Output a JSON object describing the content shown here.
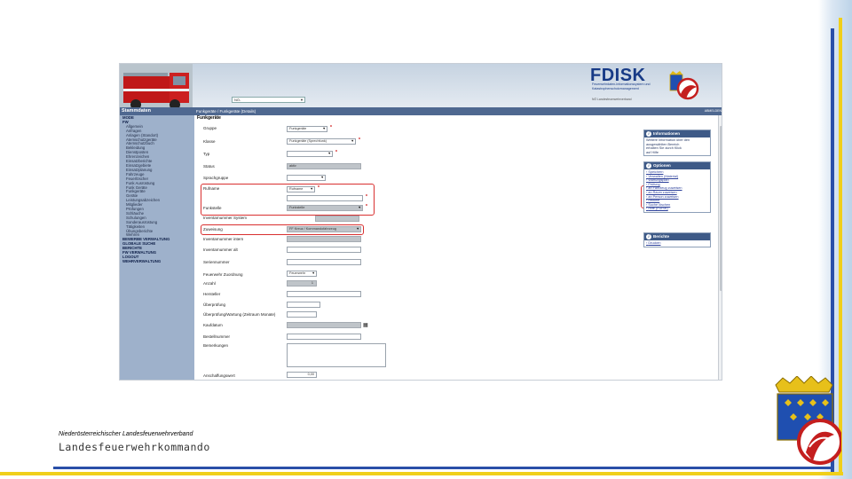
{
  "app": {
    "title": "FDISK",
    "subtitle_line1": "Feuerwehrdaten-Informationssystem und",
    "subtitle_line2": "Katastrophenschutzmanagement",
    "small_note": "NÖ Landesfeuerwehrverband",
    "mode": "Stammdaten",
    "breadcrumb": "Funkgeräte / Funkgeräte (Details)",
    "user_select": "NÖ-",
    "top_right": "ABMELDEN"
  },
  "sidebar": {
    "items": [
      {
        "label": "MODE",
        "level": 0
      },
      {
        "label": "FW",
        "level": 0
      },
      {
        "label": "Allgemein",
        "level": 1
      },
      {
        "label": "Anfragen",
        "level": 1
      },
      {
        "label": "Anlagen (Standort)",
        "level": 1
      },
      {
        "label": "Atemschutzgeräte",
        "level": 1
      },
      {
        "label": "Atemschutzbuch",
        "level": 1
      },
      {
        "label": "Bekleidung",
        "level": 1
      },
      {
        "label": "Dienstposten",
        "level": 1
      },
      {
        "label": "Ehrenzeichen",
        "level": 1
      },
      {
        "label": "Einsatzberichte",
        "level": 1
      },
      {
        "label": "Einsatzgebiete",
        "level": 1
      },
      {
        "label": "Einsatzplanung",
        "level": 1
      },
      {
        "label": "Fahrzeuge",
        "level": 1
      },
      {
        "label": "Feuerlöscher",
        "level": 1
      },
      {
        "label": "Funk Ausrüstung",
        "level": 1
      },
      {
        "label": "Funk Geräte",
        "level": 1
      },
      {
        "label": "Funkgeräte",
        "level": 1
      },
      {
        "label": "Geräte",
        "level": 1
      },
      {
        "label": "Leistungsabzeichen",
        "level": 1
      },
      {
        "label": "Mitglieder",
        "level": 1
      },
      {
        "label": "Prüfungen",
        "level": 1
      },
      {
        "label": "Schläuche",
        "level": 1
      },
      {
        "label": "Schulungen",
        "level": 1
      },
      {
        "label": "Sonderausrüstung",
        "level": 1
      },
      {
        "label": "Tätigkeiten",
        "level": 1
      },
      {
        "label": "Übungsberichte",
        "level": 1
      },
      {
        "label": "Wehren",
        "level": 1
      },
      {
        "label": "BEWERBE VERWALTUNG",
        "level": 0
      },
      {
        "label": "GLOBALE SUCHE",
        "level": 0
      },
      {
        "label": "BERICHTE",
        "level": 0
      },
      {
        "label": "FW VERWALTUNG",
        "level": 0
      },
      {
        "label": "LOGOUT",
        "level": 0
      },
      {
        "label": "WEHRVERWALTUNG",
        "level": 0
      }
    ]
  },
  "form": {
    "title": "Funkgeräte",
    "gruppe_label": "Gruppe",
    "gruppe_value": "Funkgeräte",
    "klasse_label": "Klasse",
    "klasse_value": "Funkgeräte (Sprechfunk)",
    "typ_label": "Typ",
    "typ_value": "",
    "status_label": "Status",
    "status_value": "aktiv",
    "sprachgruppe_label": "Sprachgruppe",
    "sprachgruppe_value": "",
    "rufname_label": "Rufname",
    "rufname_value": "Rufname",
    "rufname2_value": "",
    "funkstelle_label": "Funkstelle",
    "funkstelle_value": "Funkstelle",
    "inv_system_label": "Inventarnummer System",
    "inv_system_value": "",
    "zuweisung_label": "Zuweisung",
    "zuweisung_value": "FF Kreuz / Kommandofahrzeug",
    "inv_intern_label": "Inventarnummer intern",
    "inv_intern_value": "",
    "inv_alt_label": "Inventarnummer alt",
    "seriennummer_label": "Seriennummer",
    "feuerwehr_label": "Feuerwehr Zuordnung",
    "feuerwehr_value": "Feuerwehr",
    "anzahl_label": "Anzahl",
    "anzahl_value": "1",
    "hersteller_label": "Hersteller",
    "ueberpruefung_label": "Überprüfung",
    "ueberpruefung2_label": "Überprüfung/Wartung (Zeitraum Monate)",
    "kaufdatum_label": "Kaufdatum",
    "bestellnummer_label": "Bestellnummer",
    "bemerkungen_label": "Bemerkungen",
    "anschaffungswert_label": "Anschaffungswert",
    "anschaffungswert_value": "0,00"
  },
  "panels": {
    "info_title": "Informationen",
    "info_lines": [
      "Weitere Information über den",
      "ausgewählten Bereich",
      "erhalten Sie durch Klick",
      "auf Hilfe"
    ],
    "options_title": "Optionen",
    "options": [
      "Speichern",
      "Verwalten (Material)",
      "Wartungsplan",
      "Prüfung",
      "an Fahrzeug zuweisen",
      "an Raum zuweisen",
      "an Person zuweisen",
      "Historie",
      "Suche löschen",
      "Hilfe (FDISK)"
    ],
    "reports_title": "Berichte",
    "reports": [
      "Drucken"
    ]
  },
  "footer": {
    "org": "Niederösterreichischer Landesfeuerwehrverband",
    "command": "Landesfeuerwehrkommando"
  },
  "colors": {
    "accent_blue": "#2a4fa8",
    "accent_yellow": "#f0cf1a",
    "highlight_red": "#d93030",
    "sidebar": "#9eb1cb",
    "panel_header": "#3e5a87"
  }
}
